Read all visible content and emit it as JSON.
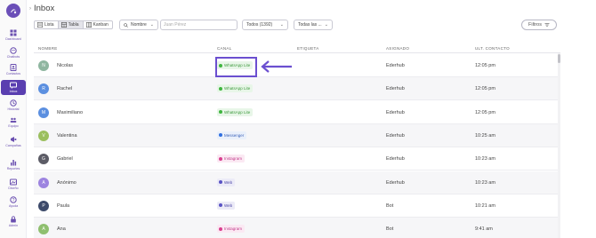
{
  "sidebar": {
    "items": [
      {
        "label": "Dashboard",
        "icon": "dashboard-icon"
      },
      {
        "label": "Chatbots",
        "icon": "chatbot-icon"
      },
      {
        "label": "Contactos",
        "icon": "contacts-icon"
      },
      {
        "label": "Inbox",
        "icon": "inbox-icon",
        "active": true
      },
      {
        "label": "Historial",
        "icon": "history-icon"
      },
      {
        "label": "Equipo",
        "icon": "team-icon"
      },
      {
        "label": "Campañas",
        "icon": "campaigns-icon"
      },
      {
        "label": "Reportes",
        "icon": "reports-icon"
      },
      {
        "label": "Diseño",
        "icon": "design-icon"
      },
      {
        "label": "Ayuda",
        "icon": "help-icon"
      },
      {
        "label": "Admin",
        "icon": "admin-icon"
      }
    ]
  },
  "header": {
    "collapse_glyph": "›",
    "title": "Inbox"
  },
  "toolbar": {
    "views": [
      {
        "label": "Lista",
        "icon": "list-icon"
      },
      {
        "label": "Tabla",
        "icon": "table-icon",
        "active": true
      },
      {
        "label": "Kanban",
        "icon": "kanban-icon"
      }
    ],
    "search_field": {
      "value": "Nombre"
    },
    "search": {
      "placeholder": "Juan Pérez"
    },
    "status_select": {
      "value": "Todos (1392)"
    },
    "date_select": {
      "value": "Todas las ..."
    },
    "filters_label": "Filtros"
  },
  "table": {
    "headers": {
      "name": "NOMBRE",
      "channel": "CANAL",
      "tag": "ETIQUETA",
      "assigned": "ASIGNADO",
      "last_contact": "ULT. CONTACTO"
    },
    "rows": [
      {
        "initial": "N",
        "name": "Nicolas",
        "channel": "WhatsApp Lite",
        "channel_type": "whatsapp",
        "assigned": "Ederhub",
        "last_contact": "12:05 pm",
        "avatar_color": "#8fb6a0"
      },
      {
        "initial": "R",
        "name": "Rachel",
        "channel": "WhatsApp Lite",
        "channel_type": "whatsapp",
        "assigned": "Ederhub",
        "last_contact": "12:05 pm",
        "avatar_color": "#5b8fe0"
      },
      {
        "initial": "M",
        "name": "Maximiliano",
        "channel": "WhatsApp Lite",
        "channel_type": "whatsapp",
        "assigned": "Ederhub",
        "last_contact": "12:05 pm",
        "avatar_color": "#5b8fe0"
      },
      {
        "initial": "V",
        "name": "Valentina",
        "channel": "Messenger",
        "channel_type": "messenger",
        "assigned": "Ederhub",
        "last_contact": "10:25 am",
        "avatar_color": "#9bbf5f"
      },
      {
        "initial": "G",
        "name": "Gabriel",
        "channel": "Instagram",
        "channel_type": "instagram",
        "assigned": "Ederhub",
        "last_contact": "10:23 am",
        "avatar_color": "#5c5c66"
      },
      {
        "initial": "A",
        "name": "Anónimo",
        "channel": "Web",
        "channel_type": "web",
        "assigned": "Ederhub",
        "last_contact": "10:23 am",
        "avatar_color": "#9d84e0"
      },
      {
        "initial": "P",
        "name": "Paula",
        "channel": "Web",
        "channel_type": "web",
        "assigned": "Bot",
        "last_contact": "10:21 am",
        "avatar_color": "#3d4a6a"
      },
      {
        "initial": "A",
        "name": "Ana",
        "channel": "Instagram",
        "channel_type": "instagram",
        "assigned": "Bot",
        "last_contact": "9:41 am",
        "avatar_color": "#8fbf6f"
      }
    ]
  },
  "colors": {
    "accent": "#5a3fb0",
    "highlight": "#6b4fd0"
  }
}
